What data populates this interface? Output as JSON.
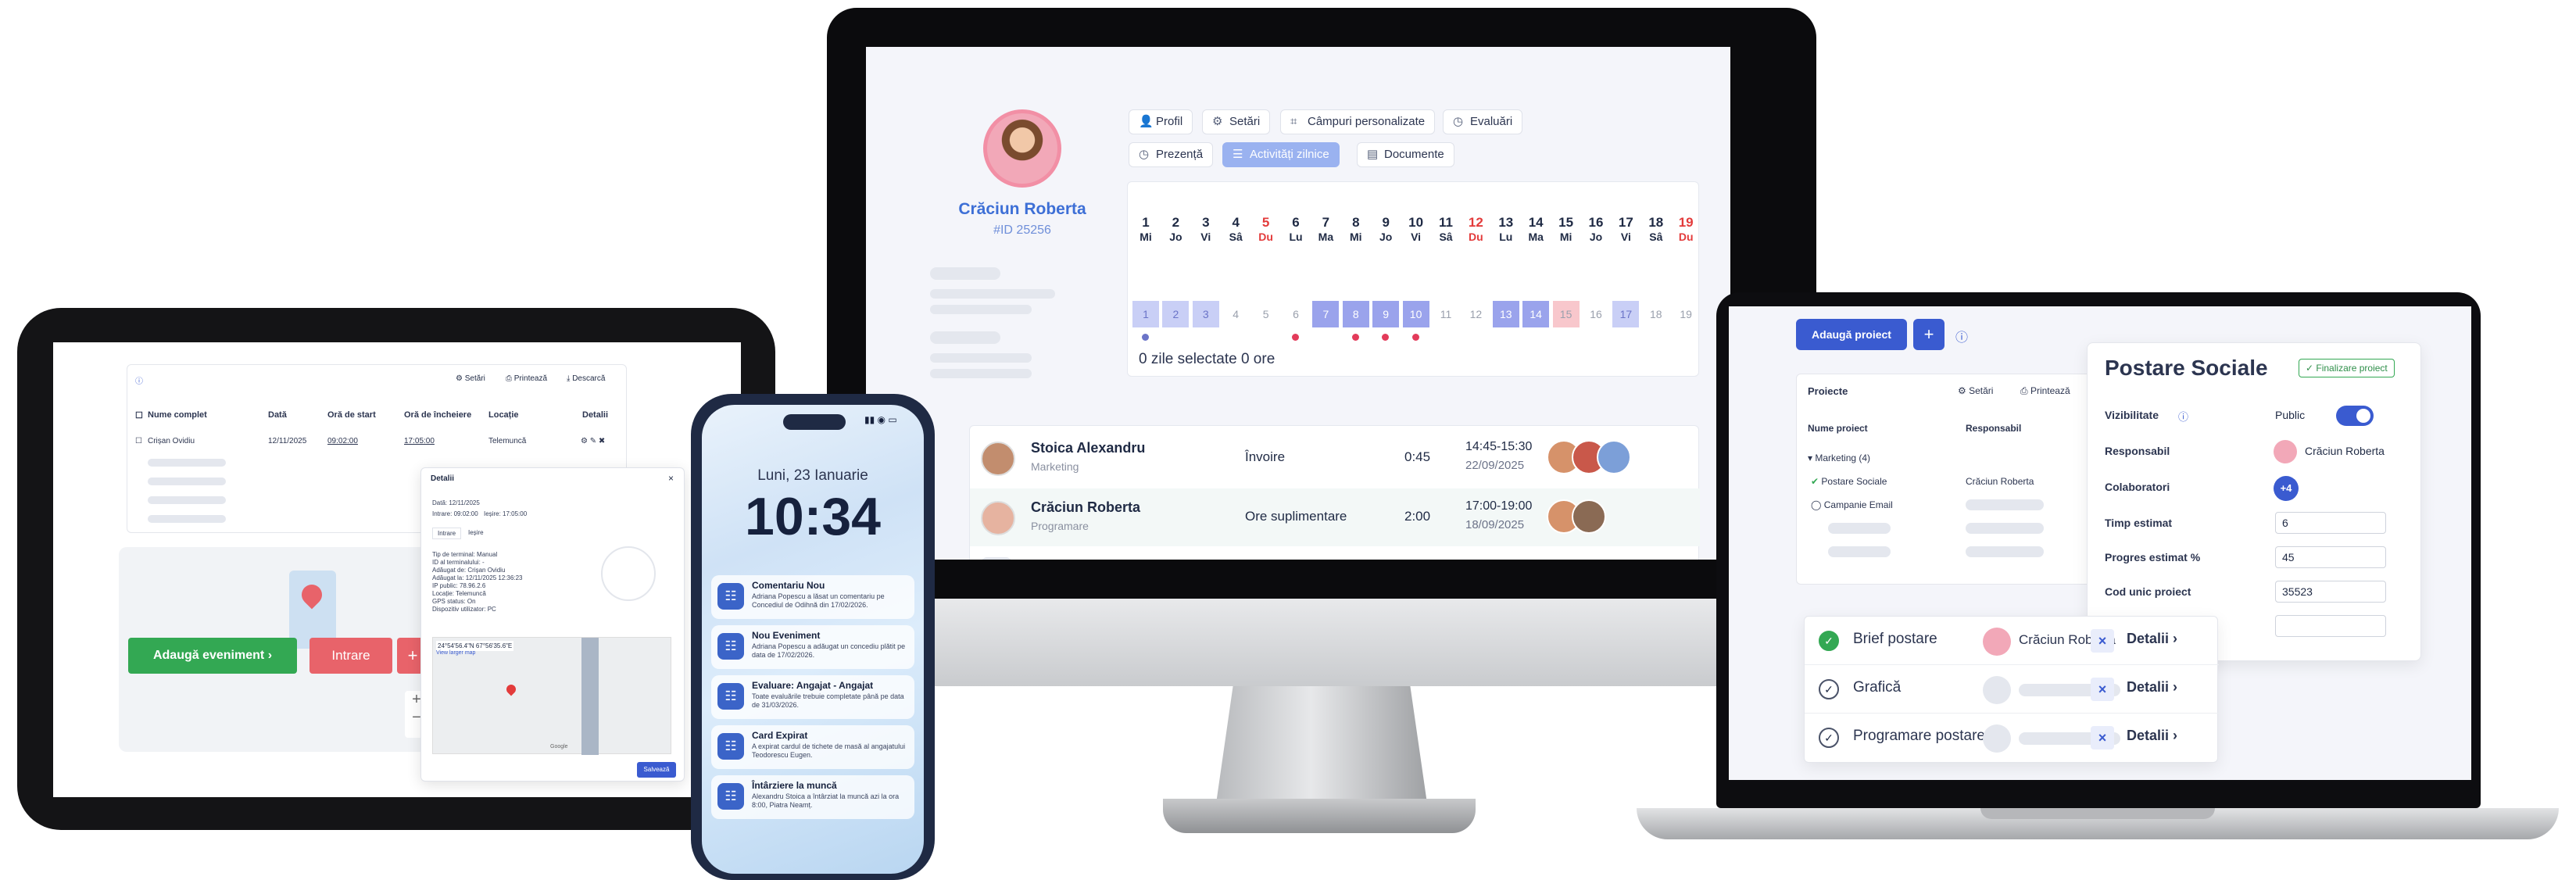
{
  "imac": {
    "profile": {
      "name": "Crăciun Roberta",
      "id": "#ID 25256"
    },
    "chips": [
      {
        "label": "Profil",
        "icon": "user-icon"
      },
      {
        "label": "Setări",
        "icon": "gear-icon"
      },
      {
        "label": "Câmpuri personalizate",
        "icon": "fields-icon"
      },
      {
        "label": "Evaluări",
        "icon": "clock-icon"
      },
      {
        "label": "Prezență",
        "icon": "clock-icon"
      },
      {
        "label": "Activități zilnice",
        "icon": "list-icon",
        "active": true
      },
      {
        "label": "Documente",
        "icon": "document-icon"
      }
    ],
    "calendar": {
      "days": [
        {
          "n": "1",
          "w": "Mi"
        },
        {
          "n": "2",
          "w": "Jo"
        },
        {
          "n": "3",
          "w": "Vi"
        },
        {
          "n": "4",
          "w": "Sâ"
        },
        {
          "n": "5",
          "w": "Du",
          "red": true
        },
        {
          "n": "6",
          "w": "Lu"
        },
        {
          "n": "7",
          "w": "Ma"
        },
        {
          "n": "8",
          "w": "Mi"
        },
        {
          "n": "9",
          "w": "Jo"
        },
        {
          "n": "10",
          "w": "Vi"
        },
        {
          "n": "11",
          "w": "Sâ"
        },
        {
          "n": "12",
          "w": "Du",
          "red": true
        },
        {
          "n": "13",
          "w": "Lu"
        },
        {
          "n": "14",
          "w": "Ma"
        },
        {
          "n": "15",
          "w": "Mi"
        },
        {
          "n": "16",
          "w": "Jo"
        },
        {
          "n": "17",
          "w": "Vi"
        },
        {
          "n": "18",
          "w": "Sâ"
        },
        {
          "n": "19",
          "w": "Du",
          "red": true
        }
      ],
      "summary": "0 zile selectate 0 ore"
    },
    "attendance": [
      {
        "name": "Stoica Alexandru",
        "dept": "Marketing",
        "type": "Învoire",
        "duration": "0:45",
        "time": "14:45-15:30",
        "date": "22/09/2025"
      },
      {
        "name": "Crăciun Roberta",
        "dept": "Programare",
        "type": "Ore suplimentare",
        "duration": "2:00",
        "time": "17:00-19:00",
        "date": "18/09/2025"
      }
    ]
  },
  "tablet": {
    "toolbar": {
      "settings": "Setări",
      "print": "Printează",
      "download": "Descarcă"
    },
    "columns": [
      "Nume complet",
      "Dată",
      "Oră de start",
      "Oră de încheiere",
      "Locație",
      "Detalii"
    ],
    "row": {
      "name": "Crișan Ovidiu",
      "date": "12/11/2025",
      "start": "09:02:00",
      "end": "17:05:00",
      "location": "Telemuncă"
    },
    "add_event": "Adaugă eveniment",
    "checkin": "Intrare",
    "plus": "+",
    "details": {
      "title": "Detalii",
      "date_line": "Dată: 12/11/2025",
      "entry_line": "Intrare: 09:02:00",
      "exit_line": "Ieșire: 17:05:00",
      "tabs": [
        "Intrare",
        "Ieșire"
      ],
      "fields": [
        "Tip de terminal: Manual",
        "ID al terminalului: -",
        "Adăugat de: Crișan Ovidiu",
        "Adăugat la: 12/11/2025 12:36:23",
        "IP public: 78.96.2.6",
        "Locație: Telemuncă",
        "GPS status: On",
        "Dispozitiv utilizator: PC"
      ],
      "gps_coords": "24°54'56.4\"N 67°56'35.6\"E",
      "map_link": "View larger map",
      "save": "Salvează",
      "map_credit": "Google"
    }
  },
  "phone": {
    "date": "Luni, 23 Ianuarie",
    "time": "10:34",
    "notifications": [
      {
        "title": "Comentariu Nou",
        "body": "Adriana Popescu a lăsat un comentariu pe Concediul de Odihnă din 17/02/2026."
      },
      {
        "title": "Nou Eveniment",
        "body": "Adriana Popescu a adăugat un concediu plătit pe data de 17/02/2026."
      },
      {
        "title": "Evaluare: Angajat - Angajat",
        "body": "Toate evaluările trebuie completate până pe data de 31/03/2026."
      },
      {
        "title": "Card Expirat",
        "body": "A expirat cardul de tichete de masă al angajatului Teodorescu Eugen."
      },
      {
        "title": "Întârziere la muncă",
        "body": "Alexandru Stoica a întârziat la muncă azi la ora 8:00, Piatra Neamț."
      }
    ]
  },
  "laptop": {
    "add_project": "Adaugă proiect",
    "plus": "+",
    "table": {
      "title": "Proiecte",
      "settings": "Setări",
      "print": "Printează",
      "col_name": "Nume proiect",
      "col_resp": "Responsabil",
      "group": "Marketing (4)",
      "rows": [
        {
          "name": "Postare Sociale",
          "resp": "Crăciun Roberta"
        },
        {
          "name": "Campanie Email",
          "resp": ""
        }
      ]
    },
    "panel": {
      "title": "Postare Sociale",
      "finalize": "✓ Finalizare proiect",
      "visibility_label": "Vizibilitate",
      "visibility_value": "Public",
      "resp_label": "Responsabil",
      "resp_value": "Crăciun Roberta",
      "collab_label": "Colaboratori",
      "collab_value": "+4",
      "time_label": "Timp estimat",
      "time_value": "6",
      "progress_label": "Progres estimat %",
      "progress_value": "45",
      "code_label": "Cod unic proiect",
      "code_value": "35523"
    },
    "tasks": [
      {
        "name": "Brief postare",
        "resp": "Crăciun Roberta",
        "done": true,
        "details": "Detalii"
      },
      {
        "name": "Grafică",
        "resp": "",
        "done": false,
        "details": "Detalii"
      },
      {
        "name": "Programare postare",
        "resp": "",
        "done": false,
        "details": "Detalii"
      }
    ]
  },
  "colors": {
    "accent": "#3a5bd0",
    "green": "#33a853",
    "red": "#e8636a",
    "calendar_selected": "#9aa3ec"
  }
}
